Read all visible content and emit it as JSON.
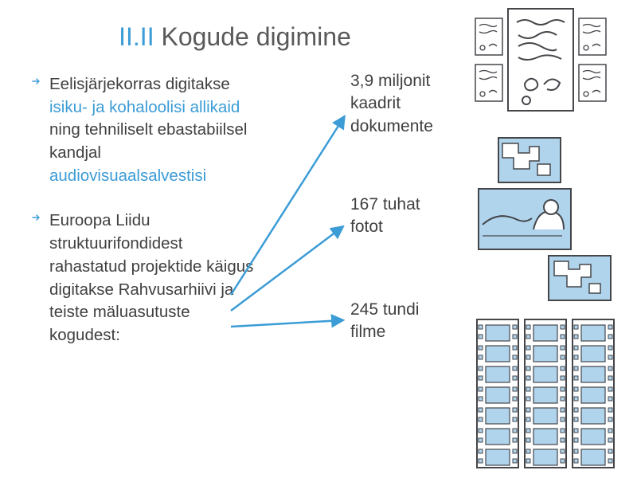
{
  "title": {
    "prefix": "II.II",
    "rest": " Kogude digimine"
  },
  "bullets": [
    {
      "pre": "Eelisjärjekorras digitakse ",
      "hl1": "isiku- ja kohaloolisi allikaid",
      "mid": " ning tehniliselt ebastabiilsel kandjal ",
      "hl2": "audiovisuaalsalvestisi"
    },
    {
      "text": "Euroopa Liidu struktuurifondidest rahastatud projektide käigus digitakse Rahvusarhiivi ja teiste mäluasutuste kogudest:"
    }
  ],
  "stats": [
    {
      "line1": "3,9 miljonit",
      "line2": "kaadrit",
      "line3": "dokumente"
    },
    {
      "line1": "167 tuhat",
      "line2": "fotot"
    },
    {
      "line1": "245 tundi",
      "line2": "filme"
    }
  ],
  "colors": {
    "accent": "#3b9cd6",
    "arrow": "#3b9cd6",
    "outline": "#44464a",
    "fill": "#b1d4ed"
  }
}
